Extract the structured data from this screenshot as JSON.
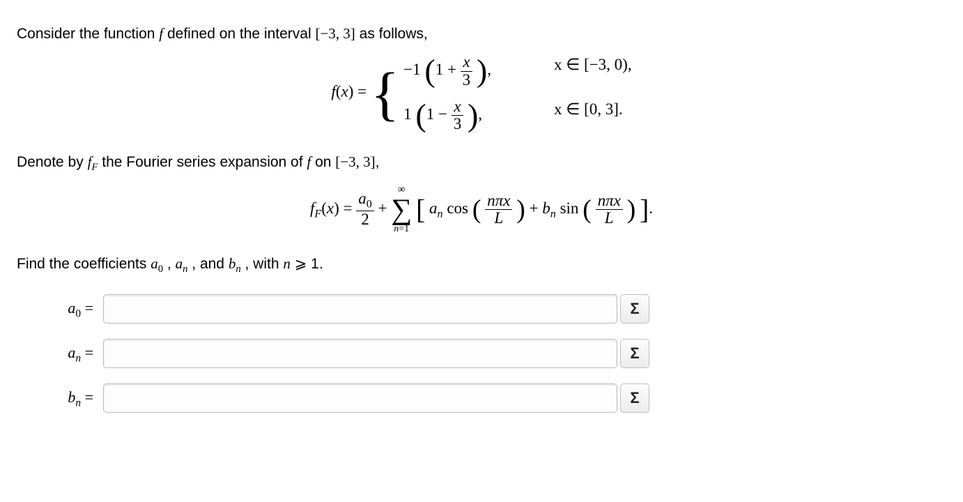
{
  "p1": "Consider the function ",
  "p1b": " defined on the interval ",
  "p1c": " as follows,",
  "interval": "[−3, 3]",
  "piecewise": {
    "lhs_a": "f",
    "lhs_b": "(",
    "lhs_c": "x",
    "lhs_d": ") =",
    "c1a": "−1",
    "c1b": "1 +",
    "c1c_num": "x",
    "c1c_den": "3",
    "c1d": ",",
    "c1cond": "x ∈ [−3, 0),",
    "c2a": "1",
    "c2b": "1 −",
    "c2c_num": "x",
    "c2c_den": "3",
    "c2d": ",",
    "c2cond": "x ∈ [0, 3]."
  },
  "p2": "Denote by ",
  "p2b": " the Fourier series expansion of ",
  "p2c": " on ",
  "p2d": ",",
  "ff_a": "f",
  "ff_b": "F",
  "series": {
    "lhs_a": "f",
    "lhs_b": "F",
    "lhs_c": "(",
    "lhs_d": "x",
    "lhs_e": ") =",
    "a0num": "a",
    "a0zero": "0",
    "a0den": "2",
    "plus": " + ",
    "sum_top": "∞",
    "sum_sigma": "∑",
    "sum_low_a": "n",
    "sum_low_b": "=1",
    "an_a": "a",
    "an_n": "n",
    "cos": " cos",
    "frac_num_a": "nπx",
    "frac_den": "L",
    "plus2": " + ",
    "bn_a": "b",
    "bn_n": "n",
    "sin": " sin",
    "dot": "."
  },
  "p3a": "Find the coefficients ",
  "p3comma": " , ",
  "p3and": " , and ",
  "p3with": " , with ",
  "p3cond": " ⩾ 1.",
  "labels": {
    "a0_a": "a",
    "a0_0": "0",
    "eq": " =",
    "an_a": "a",
    "an_n": "n",
    "bn_a": "b",
    "bn_n": "n"
  },
  "sigma_btn": "Σ"
}
